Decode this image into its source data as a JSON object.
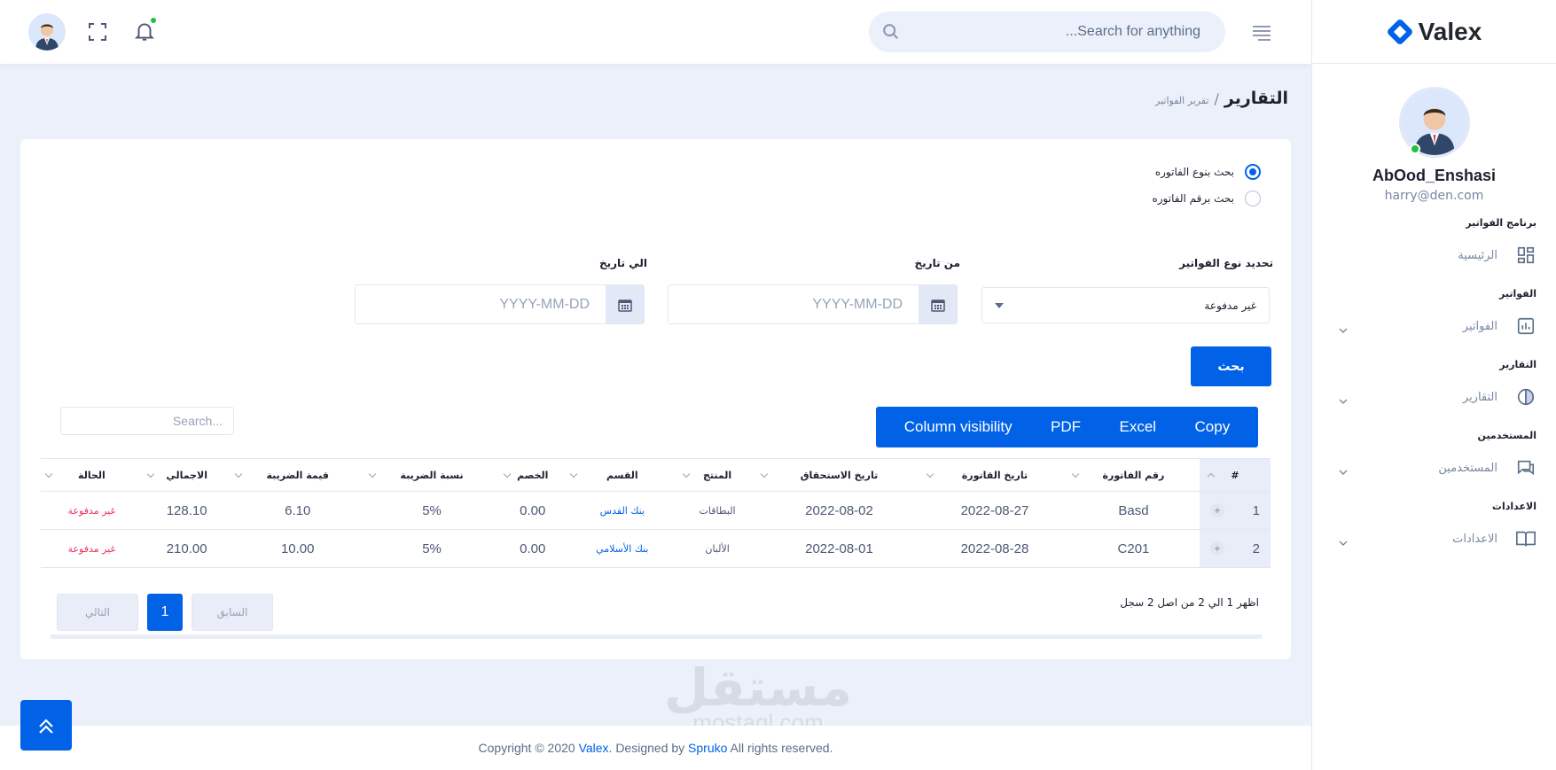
{
  "brand": {
    "name": "Valex"
  },
  "header": {
    "search_placeholder": "Search for anything..."
  },
  "sidebar": {
    "user_name": "AbOod_Enshasi",
    "user_email": "harry@den.com",
    "sections": [
      {
        "category": "برنامج الفواتير",
        "label": "الرئيسية",
        "icon": "dashboard-icon",
        "has_chevron": false
      },
      {
        "category": "الفواتير",
        "label": "الفواتير",
        "icon": "bar-chart-icon",
        "has_chevron": true
      },
      {
        "category": "التقارير",
        "label": "التقارير",
        "icon": "pie-chart-icon",
        "has_chevron": true
      },
      {
        "category": "المستخدمين",
        "label": "المستخدمين",
        "icon": "chat-icon",
        "has_chevron": true
      },
      {
        "category": "الاعدادات",
        "label": "الاعدادات",
        "icon": "book-icon",
        "has_chevron": true
      }
    ]
  },
  "breadcrumb": {
    "title": "التقارير",
    "separator": "/",
    "sub": "تقرير الفواتير"
  },
  "filters": {
    "radio_type": "بحث بنوع الفاتوره",
    "radio_number": "بحث برقم الفاتوره",
    "type_label": "تحديد نوع الفواتير",
    "type_value": "غير مدفوعة",
    "from_label": "من تاريخ",
    "to_label": "الي تاريخ",
    "date_placeholder": "YYYY-MM-DD",
    "search_button": "بحث"
  },
  "table_tools": {
    "buttons": [
      "Copy",
      "Excel",
      "PDF",
      "Column visibility"
    ],
    "search_placeholder": "Search..."
  },
  "table": {
    "headers": [
      "#",
      "رقم الفاتورة",
      "تاريخ القاتورة",
      "تاريخ الاستحقاق",
      "المنتج",
      "القسم",
      "الخصم",
      "نسبة الضريبة",
      "قيمة الضريبة",
      "الاجمالي",
      "الحالة"
    ],
    "rows": [
      [
        "1",
        "Basd",
        "2022-08-27",
        "2022-08-02",
        "البطاقات",
        "بنك القدس",
        "0.00",
        "5%",
        "6.10",
        "128.10",
        "غير مدفوعة"
      ],
      [
        "2",
        "C201",
        "2022-08-28",
        "2022-08-01",
        "الألبان",
        "بنك الأسلامي",
        "0.00",
        "5%",
        "10.00",
        "210.00",
        "غير مدفوعة"
      ]
    ],
    "info": "اظهر 1 الي 2 من اصل 2 سجل"
  },
  "pagination": {
    "prev": "السابق",
    "current": "1",
    "next": "التالي"
  },
  "watermark": {
    "ar": "مستقل",
    "en": "mostaql.com"
  },
  "footer": {
    "prefix": "Copyright © 2020 ",
    "brand": "Valex",
    "middle": ". Designed by ",
    "designer": "Spruko",
    "suffix": " All rights reserved."
  },
  "colors": {
    "primary": "#0162e8",
    "danger": "#ee335e",
    "success": "#22c03c",
    "page_bg": "#ecf0fa"
  }
}
